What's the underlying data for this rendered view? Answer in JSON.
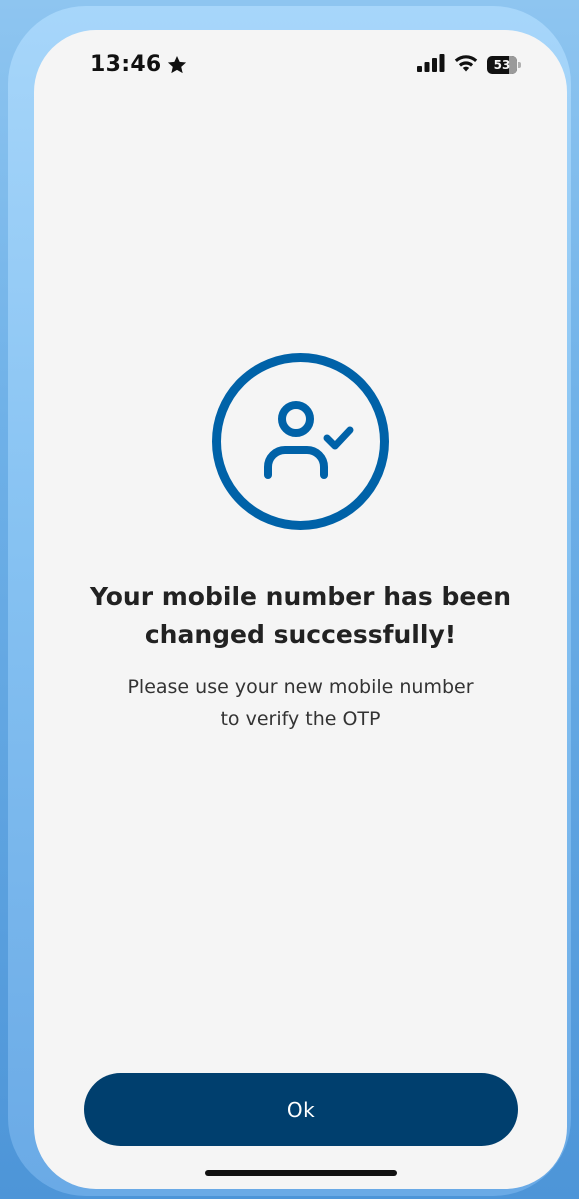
{
  "status_bar": {
    "time": "13:46",
    "battery_level": "53"
  },
  "icons": {
    "status_star": "star-icon",
    "signal": "cellular-signal-icon",
    "wifi": "wifi-icon",
    "battery": "battery-icon",
    "success": "user-check-icon"
  },
  "message": {
    "title_line1": "Your mobile number has been",
    "title_line2": "changed successfully!",
    "subtitle_line1": "Please use your new mobile number",
    "subtitle_line2": "to verify the OTP"
  },
  "actions": {
    "ok_label": "Ok"
  },
  "colors": {
    "accent": "#0062a8",
    "button_bg": "#003f6e",
    "screen_bg": "#f5f5f5"
  }
}
